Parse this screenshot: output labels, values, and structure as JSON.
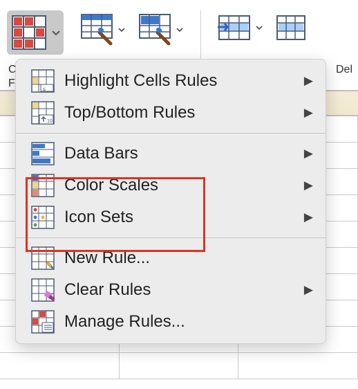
{
  "ribbon": {
    "delete_label_fragment": "Del",
    "lbl_c_fragment": "C",
    "lbl_f_fragment": "F"
  },
  "menu": {
    "highlight_cells": "Highlight Cells Rules",
    "top_bottom": "Top/Bottom Rules",
    "data_bars": "Data Bars",
    "color_scales": "Color Scales",
    "icon_sets": "Icon Sets",
    "new_rule": "New Rule...",
    "clear_rules": "Clear Rules",
    "manage_rules": "Manage Rules..."
  }
}
